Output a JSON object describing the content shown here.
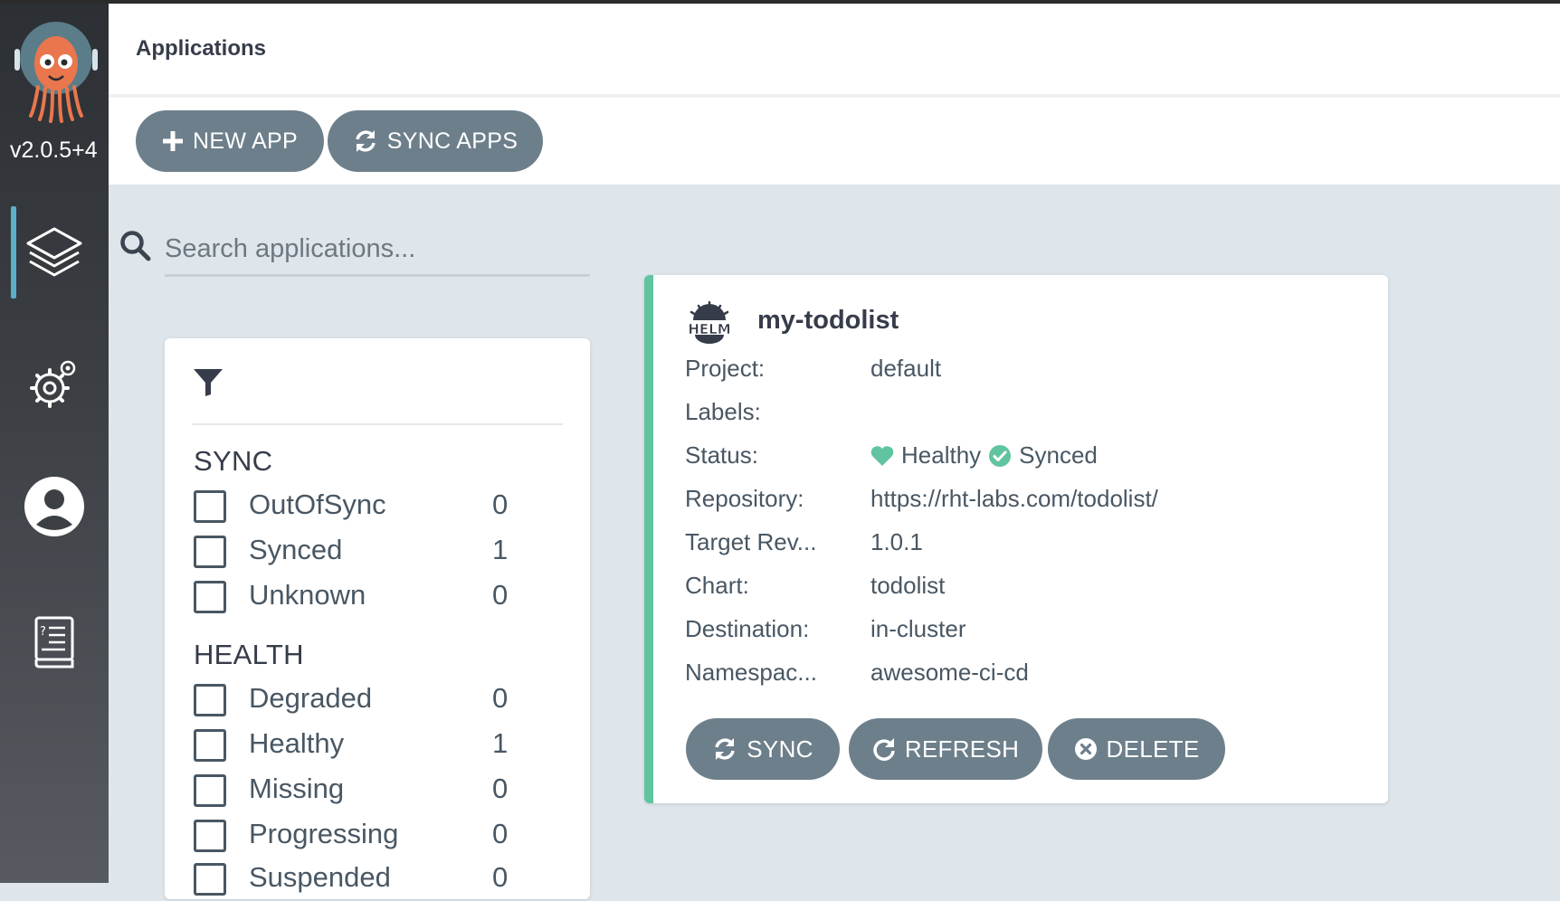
{
  "sidebar": {
    "version": "v2.0.5+4",
    "nav": [
      {
        "name": "applications",
        "icon": "layers-icon",
        "active": true
      },
      {
        "name": "settings",
        "icon": "gears-icon"
      },
      {
        "name": "user-info",
        "icon": "user-icon"
      },
      {
        "name": "docs",
        "icon": "docs-book-icon"
      }
    ]
  },
  "header": {
    "title": "Applications"
  },
  "toolbar": {
    "new_app": "NEW APP",
    "sync_apps": "SYNC APPS"
  },
  "search": {
    "placeholder": "Search applications...",
    "value": ""
  },
  "filters": {
    "sync": {
      "title": "SYNC",
      "items": [
        {
          "label": "OutOfSync",
          "count": "0"
        },
        {
          "label": "Synced",
          "count": "1"
        },
        {
          "label": "Unknown",
          "count": "0"
        }
      ]
    },
    "health": {
      "title": "HEALTH",
      "items": [
        {
          "label": "Degraded",
          "count": "0"
        },
        {
          "label": "Healthy",
          "count": "1"
        },
        {
          "label": "Missing",
          "count": "0"
        },
        {
          "label": "Progressing",
          "count": "0"
        },
        {
          "label": "Suspended",
          "count": "0"
        }
      ]
    }
  },
  "app": {
    "name": "my-todolist",
    "icon": "helm-icon",
    "fields": {
      "project": {
        "label": "Project:",
        "value": "default"
      },
      "labels": {
        "label": "Labels:",
        "value": ""
      },
      "status": {
        "label": "Status:",
        "health": "Healthy",
        "sync": "Synced"
      },
      "repository": {
        "label": "Repository:",
        "value": "https://rht-labs.com/todolist/"
      },
      "target_rev": {
        "label": "Target Rev...",
        "value": "1.0.1"
      },
      "chart": {
        "label": "Chart:",
        "value": "todolist"
      },
      "destination": {
        "label": "Destination:",
        "value": "in-cluster"
      },
      "namespace": {
        "label": "Namespac...",
        "value": "awesome-ci-cd"
      }
    },
    "actions": {
      "sync": "SYNC",
      "refresh": "REFRESH",
      "delete": "DELETE"
    }
  },
  "colors": {
    "sidebar_bg": "#2c2f33",
    "accent_active": "#5ab0c7",
    "healthy_green": "#61c4a0",
    "button_bg": "#6d7f8b",
    "page_bg": "#dee6eb"
  }
}
